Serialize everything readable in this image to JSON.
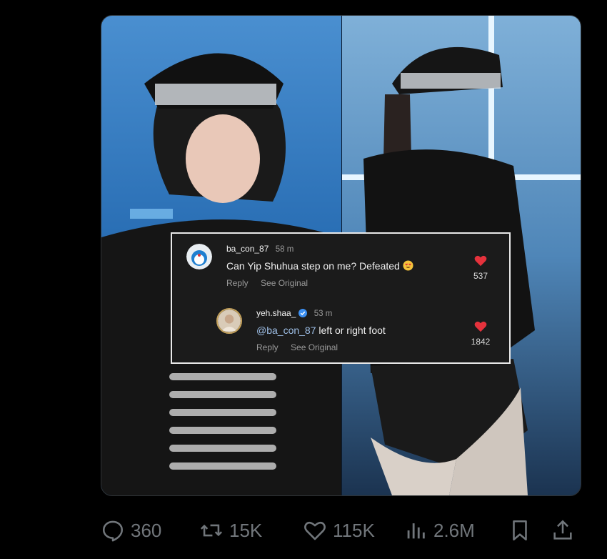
{
  "comments": [
    {
      "username": "ba_con_87",
      "time": "58 m",
      "text": "Can Yip Shuhua step on me? Defeated",
      "reply_label": "Reply",
      "see_original_label": "See Original",
      "likes": "537"
    },
    {
      "username": "yeh.shaa_",
      "time": "53 m",
      "mention": "@ba_con_87",
      "text": " left or right foot",
      "reply_label": "Reply",
      "see_original_label": "See Original",
      "likes": "1842"
    }
  ],
  "actions": {
    "replies": "360",
    "reposts": "15K",
    "likes": "115K",
    "views": "2.6M"
  },
  "colors": {
    "heart": "#e5323c",
    "verified": "#3b8ff2",
    "muted": "#71767b",
    "mention": "#9fc0e8"
  }
}
